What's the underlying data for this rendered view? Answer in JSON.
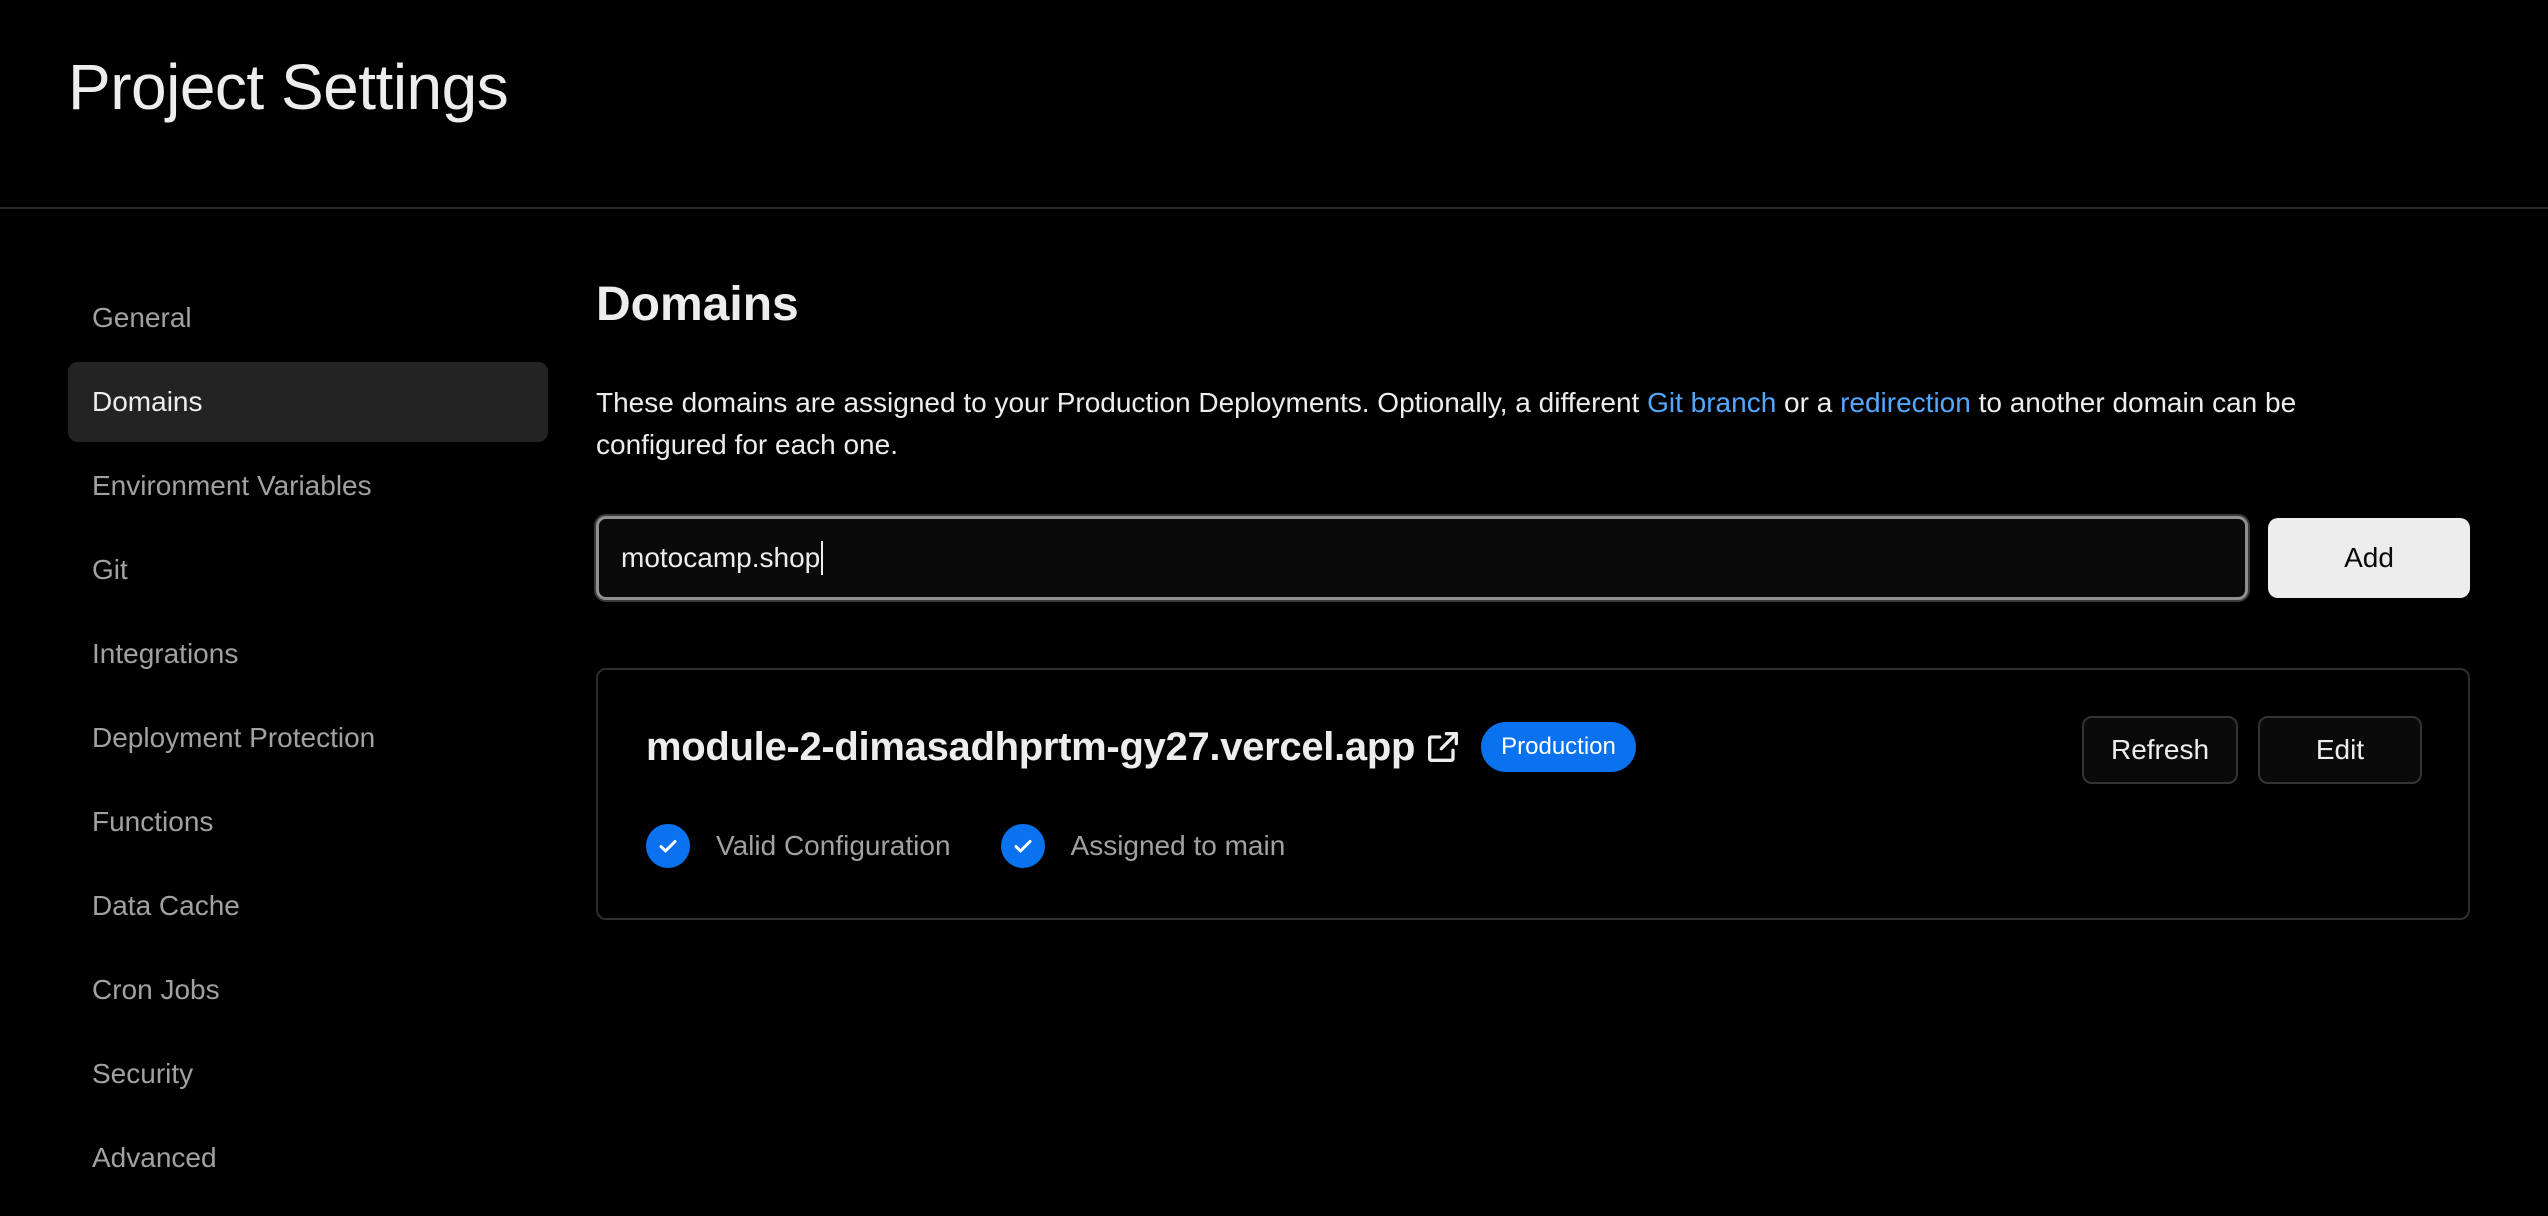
{
  "header": {
    "title": "Project Settings"
  },
  "sidebar": {
    "items": [
      {
        "label": "General",
        "active": false
      },
      {
        "label": "Domains",
        "active": true
      },
      {
        "label": "Environment Variables",
        "active": false
      },
      {
        "label": "Git",
        "active": false
      },
      {
        "label": "Integrations",
        "active": false
      },
      {
        "label": "Deployment Protection",
        "active": false
      },
      {
        "label": "Functions",
        "active": false
      },
      {
        "label": "Data Cache",
        "active": false
      },
      {
        "label": "Cron Jobs",
        "active": false
      },
      {
        "label": "Security",
        "active": false
      },
      {
        "label": "Advanced",
        "active": false
      }
    ]
  },
  "main": {
    "title": "Domains",
    "description": {
      "part1": "These domains are assigned to your Production Deployments. Optionally, a different ",
      "link1": "Git branch",
      "part2": " or a ",
      "link2": "redirection",
      "part3": " to another domain can be configured for each one."
    },
    "add_form": {
      "input_value": "motocamp.shop",
      "add_label": "Add"
    },
    "domain_card": {
      "domain": "module-2-dimasadhprtm-gy27.vercel.app",
      "badge": "Production",
      "refresh_label": "Refresh",
      "edit_label": "Edit",
      "statuses": [
        {
          "label": "Valid Configuration",
          "icon": "check-circle-icon"
        },
        {
          "label": "Assigned to main",
          "icon": "check-circle-icon"
        }
      ]
    }
  },
  "colors": {
    "accent": "#0a72ef",
    "link": "#52a8ff",
    "background": "#000000"
  }
}
